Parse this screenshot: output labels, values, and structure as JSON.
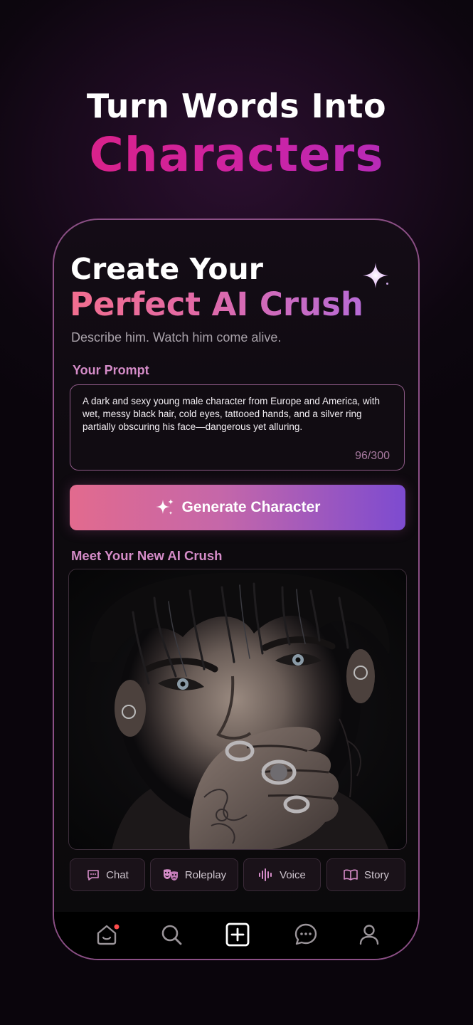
{
  "hero": {
    "line1": "Turn Words Into",
    "line2": "Characters"
  },
  "card": {
    "title_line1": "Create Your",
    "title_line2": "Perfect AI Crush",
    "subtitle": "Describe him. Watch him come alive."
  },
  "prompt": {
    "label": "Your Prompt",
    "value": "A dark and sexy young male character from Europe and America, with wet, messy black hair, cold eyes, tattooed hands, and a silver ring partially obscuring his face—dangerous yet alluring.",
    "count": "96/300"
  },
  "generate_button": {
    "label": "Generate Character",
    "icon": "sparkle-icon"
  },
  "result": {
    "label": "Meet Your New AI Crush",
    "image": "character-portrait"
  },
  "chips": [
    {
      "label": "Chat",
      "icon": "chat-bubble-icon"
    },
    {
      "label": "Roleplay",
      "icon": "theater-masks-icon"
    },
    {
      "label": "Voice",
      "icon": "soundwave-icon"
    },
    {
      "label": "Story",
      "icon": "open-book-icon"
    }
  ],
  "nav": [
    {
      "name": "home",
      "icon": "home-icon",
      "has_notification": true
    },
    {
      "name": "search",
      "icon": "search-icon"
    },
    {
      "name": "create",
      "icon": "plus-square-icon",
      "active": true
    },
    {
      "name": "messages",
      "icon": "message-icon"
    },
    {
      "name": "profile",
      "icon": "user-icon"
    }
  ],
  "colors": {
    "accent_pink": "#e0217e",
    "accent_purple": "#a72fc6",
    "label_pink": "#d58cc8",
    "notification_dot": "#ff4d4d"
  }
}
